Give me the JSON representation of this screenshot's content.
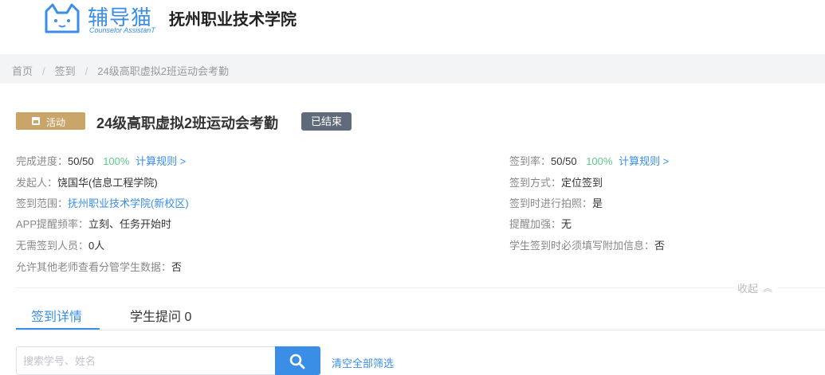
{
  "header": {
    "logo_cn": "辅导猫",
    "logo_en": "Counselor AssistanT",
    "school_name": "抚州职业技术学院"
  },
  "breadcrumb": [
    "首页",
    "签到",
    "24级高职虚拟2班运动会考勤"
  ],
  "activity": {
    "tag": "活动",
    "title": "24级高职虚拟2班运动会考勤",
    "status": "已结束"
  },
  "left_info": {
    "progress_label": "完成进度：",
    "progress_value": "50/50",
    "progress_pct": "100%",
    "rule_link": "计算规则 >",
    "initiator_label": "发起人：",
    "initiator_value": "饶国华(信息工程学院)",
    "scope_label": "签到范围：",
    "scope_value": "抚州职业技术学院(新校区)",
    "reminder_label": "APP提醒频率：",
    "reminder_value": "立刻、任务开始时",
    "exempt_label": "无需签到人员：",
    "exempt_value": "0人",
    "share_label": "允许其他老师查看分管学生数据：",
    "share_value": "否"
  },
  "right_info": {
    "rate_label": "签到率：",
    "rate_value": "50/50",
    "rate_pct": "100%",
    "rule_link": "计算规则 >",
    "method_label": "签到方式：",
    "method_value": "定位签到",
    "photo_label": "签到时进行拍照：",
    "photo_value": "是",
    "enhance_label": "提醒加强：",
    "enhance_value": "无",
    "extra_label": "学生签到时必须填写附加信息：",
    "extra_value": "否"
  },
  "collapse_label": "收起",
  "tabs": [
    {
      "label": "签到详情",
      "active": true
    },
    {
      "label": "学生提问 0",
      "active": false
    }
  ],
  "search": {
    "placeholder": "搜索学号、姓名",
    "clear_label": "清空全部筛选"
  },
  "colors": {
    "accent": "#3a8ee6",
    "tag": "#c9a56a",
    "status": "#5f6b7a",
    "percent": "#5fc98a"
  }
}
